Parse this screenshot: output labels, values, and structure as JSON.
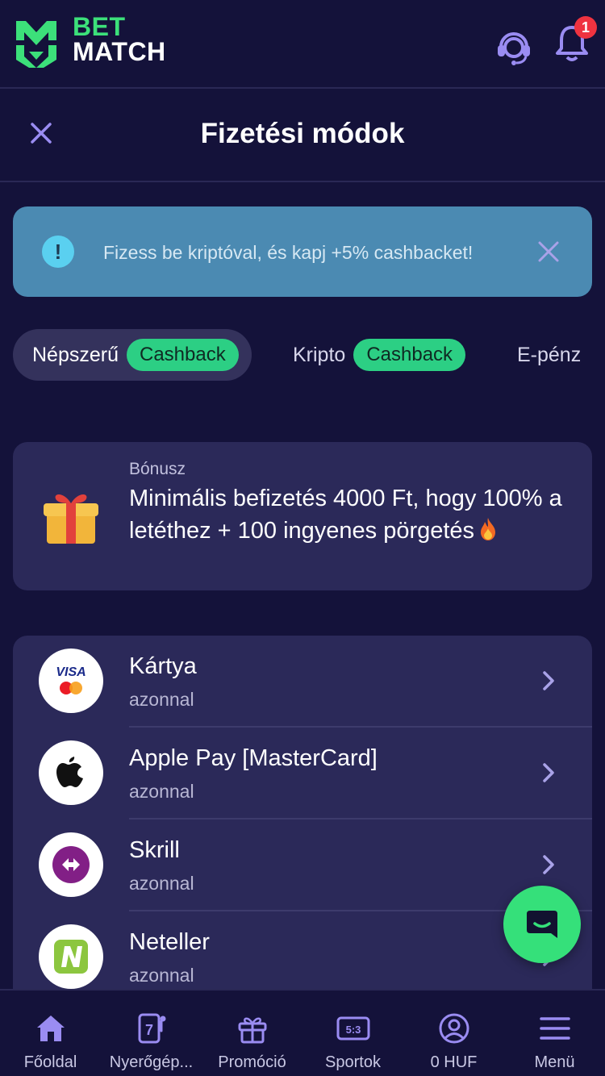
{
  "brand": {
    "line1": "BET",
    "line2": "MATCH"
  },
  "header": {
    "notification_count": "1"
  },
  "page": {
    "title": "Fizetési módok"
  },
  "alert": {
    "text": "Fizess be kriptóval, és kapj +5% cashbacket!"
  },
  "tabs": [
    {
      "label": "Népszerű",
      "badge": "Cashback",
      "active": true
    },
    {
      "label": "Kripto",
      "badge": "Cashback",
      "active": false
    },
    {
      "label": "E-pénz",
      "badge": "",
      "active": false
    }
  ],
  "bonus": {
    "label": "Bónusz",
    "text": "Minimális befizetés 4000 Ft, hogy 100% a letéthez + 100 ingyenes pörgetés"
  },
  "methods": [
    {
      "name": "Kártya",
      "sub": "azonnal",
      "icon": "visa-mastercard-icon"
    },
    {
      "name": "Apple Pay [MasterCard]",
      "sub": "azonnal",
      "icon": "apple-icon"
    },
    {
      "name": "Skrill",
      "sub": "azonnal",
      "icon": "skrill-icon"
    },
    {
      "name": "Neteller",
      "sub": "azonnal",
      "icon": "neteller-icon"
    }
  ],
  "nav": [
    {
      "label": "Főoldal",
      "icon": "home-icon"
    },
    {
      "label": "Nyerőgép...",
      "icon": "slot-machine-icon"
    },
    {
      "label": "Promóció",
      "icon": "gift-icon"
    },
    {
      "label": "Sportok",
      "icon": "scoreboard-icon"
    },
    {
      "label": "0 HUF",
      "icon": "user-icon"
    },
    {
      "label": "Menü",
      "icon": "menu-icon"
    }
  ],
  "colors": {
    "background": "#14123a",
    "card": "#2b2959",
    "accent_green": "#3ce07a",
    "cashback_pill": "#2ccf84",
    "alert_bg": "#4b8ab2",
    "badge_red": "#ef3340"
  }
}
